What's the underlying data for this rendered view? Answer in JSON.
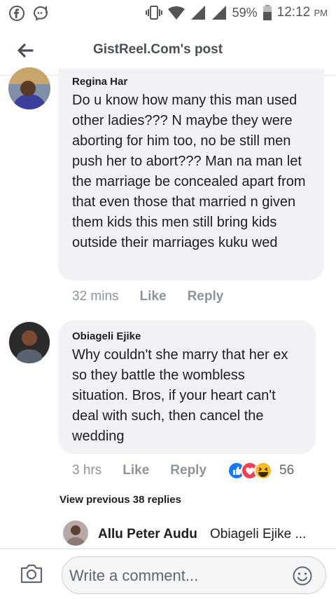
{
  "status_bar": {
    "battery": "59%",
    "time": "12:12",
    "ampm": "PM"
  },
  "header": {
    "title": "GistReel.Com's post"
  },
  "comments": [
    {
      "author": "Regina Har",
      "text": "Do u know how many this man used other ladies??? N maybe they were aborting for him too, no be still men push her to abort??? Man na man let the marriage be concealed apart from that even those that married n given them kids this men still bring kids outside their marriages kuku wed",
      "time": "32 mins",
      "like_label": "Like",
      "reply_label": "Reply"
    },
    {
      "author": "Obiageli Ejike",
      "text": "Why couldn't she marry that her ex so they battle the wombless situation. Bros, if your heart can't deal with such, then cancel the wedding",
      "time": "3 hrs",
      "like_label": "Like",
      "reply_label": "Reply",
      "reaction_count": "56"
    }
  ],
  "view_previous": "View previous 38 replies",
  "reply_preview": {
    "author": "Allu Peter Audu",
    "text": "Obiageli Ejike ..."
  },
  "composer": {
    "placeholder": "Write a comment..."
  },
  "colors": {
    "bubble": "#f0f2f5",
    "like_blue": "#1877f2",
    "love_red": "#f33e58",
    "haha_yellow": "#f7b928"
  }
}
